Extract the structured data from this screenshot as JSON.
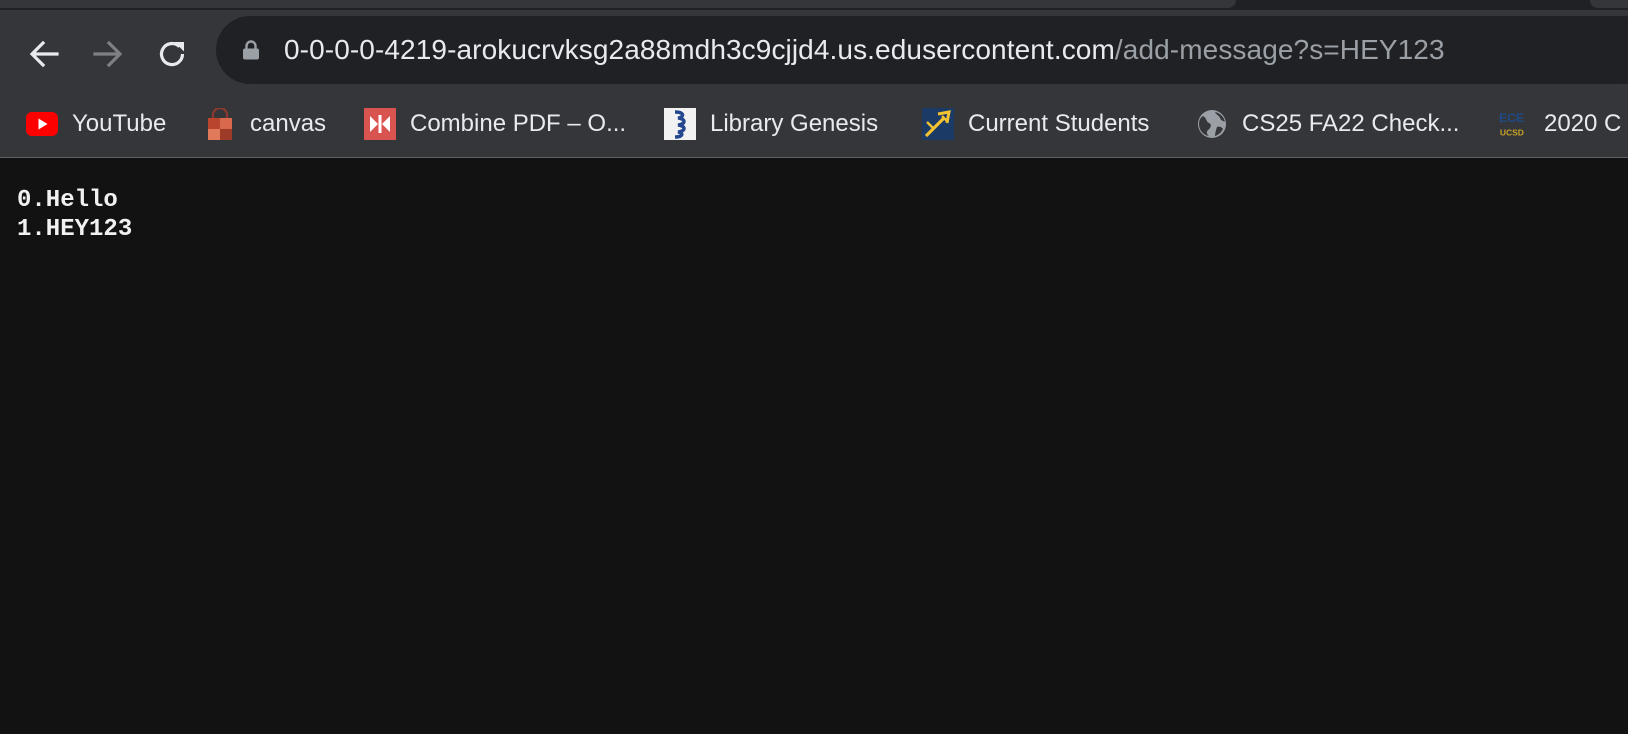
{
  "browser": {
    "nav": {
      "back_icon": "arrow-left-icon",
      "forward_icon": "arrow-right-icon",
      "reload_icon": "reload-icon"
    },
    "address_bar": {
      "lock_icon": "lock-icon",
      "host": "0-0-0-0-4219-arokucrvksg2a88mdh3c9cjjd4.us.edusercontent.com",
      "path": "/add-message?s=HEY123"
    },
    "bookmarks": [
      {
        "label": "YouTube",
        "icon": "youtube-icon"
      },
      {
        "label": "canvas",
        "icon": "canvas-icon"
      },
      {
        "label": "Combine PDF – O...",
        "icon": "combine-pdf-icon"
      },
      {
        "label": "Library Genesis",
        "icon": "library-genesis-icon"
      },
      {
        "label": "Current Students",
        "icon": "trident-icon"
      },
      {
        "label": "CS25 FA22 Check...",
        "icon": "globe-icon"
      },
      {
        "label": "2020 C",
        "icon": "ece-ucsd-icon"
      }
    ]
  },
  "page": {
    "messages": [
      "0.Hello",
      "1.HEY123"
    ]
  },
  "colors": {
    "page_background": "#121212",
    "toolbar": "#35363a",
    "omnibox": "#202124",
    "url_host": "#e8eaed",
    "url_path": "#9aa0a6",
    "youtube_red": "#ff0000"
  }
}
